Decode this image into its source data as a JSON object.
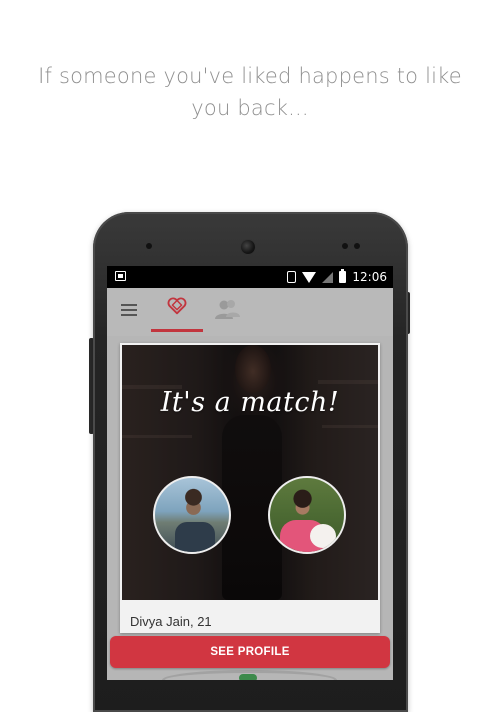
{
  "headline": {
    "line1": "If someone you've liked happens to like",
    "line2": "you back..."
  },
  "statusbar": {
    "time": "12:06",
    "icons": [
      "notification-icon",
      "vibrate-icon",
      "wifi-icon",
      "signal-icon",
      "battery-icon"
    ]
  },
  "appbar": {
    "menu_icon": "hamburger-menu-icon",
    "tabs": [
      {
        "name": "matches",
        "icon": "heart-icon",
        "active": true
      },
      {
        "name": "friends",
        "icon": "people-icon",
        "active": false
      }
    ],
    "accent_color": "#c2353e"
  },
  "card": {
    "match_text": "It's a match!",
    "name_age": "Divya Jain, 21"
  },
  "actions": {
    "see_profile_label": "SEE PROFILE",
    "button_color": "#d13641"
  }
}
